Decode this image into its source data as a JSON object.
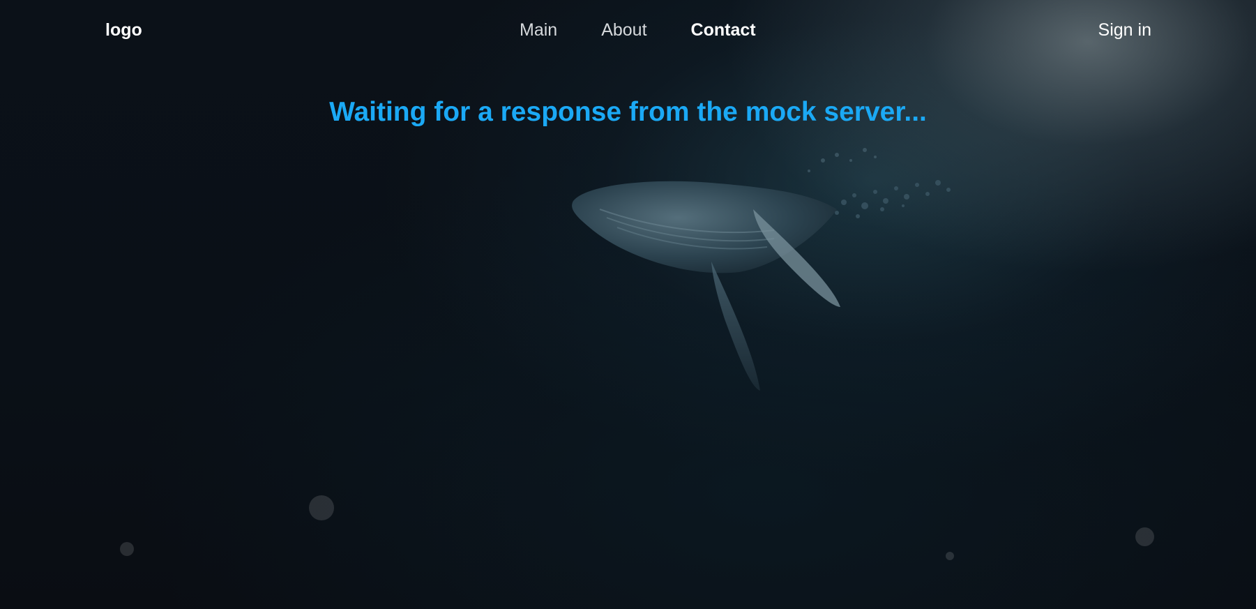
{
  "nav": {
    "logo": "logo",
    "menu": [
      {
        "label": "Main",
        "active": false
      },
      {
        "label": "About",
        "active": false
      },
      {
        "label": "Contact",
        "active": true
      }
    ],
    "signin_label": "Sign in"
  },
  "main": {
    "status_message": "Waiting for a response from the mock server..."
  },
  "colors": {
    "accent": "#1ba9f5",
    "background": "#0a0f16",
    "nav_text": "#ffffff"
  }
}
